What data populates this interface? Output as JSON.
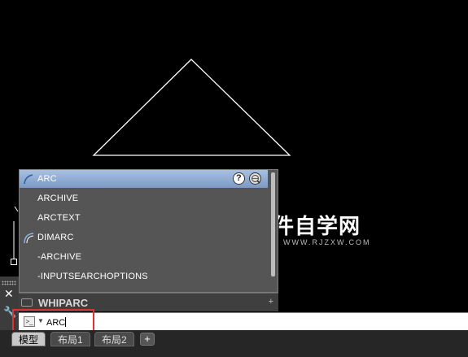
{
  "autocomplete": {
    "items": [
      {
        "label": "ARC",
        "selected": true,
        "icon": "arc-icon"
      },
      {
        "label": "ARCHIVE",
        "selected": false,
        "icon": ""
      },
      {
        "label": "ARCTEXT",
        "selected": false,
        "icon": ""
      },
      {
        "label": "DIMARC",
        "selected": false,
        "icon": "dimarc-icon"
      },
      {
        "label": "-ARCHIVE",
        "selected": false,
        "icon": ""
      },
      {
        "label": "-INPUTSEARCHOPTIONS",
        "selected": false,
        "icon": ""
      }
    ],
    "help_label": "?"
  },
  "history": {
    "last_command": "WHIPARC",
    "expand_label": "+"
  },
  "command_line": {
    "value": "ARC"
  },
  "palette": {
    "close_label": "✕",
    "settings_label": "🔧"
  },
  "tabs": [
    {
      "label": "模型",
      "active": true
    },
    {
      "label": "布局1",
      "active": false
    },
    {
      "label": "布局2",
      "active": false
    }
  ],
  "tab_add_label": "+",
  "watermark": {
    "main": "软件自学网",
    "sub": "WWW.RJZXW.COM"
  },
  "colors": {
    "highlight": "#e03030",
    "selection": "#8aa6cf"
  }
}
